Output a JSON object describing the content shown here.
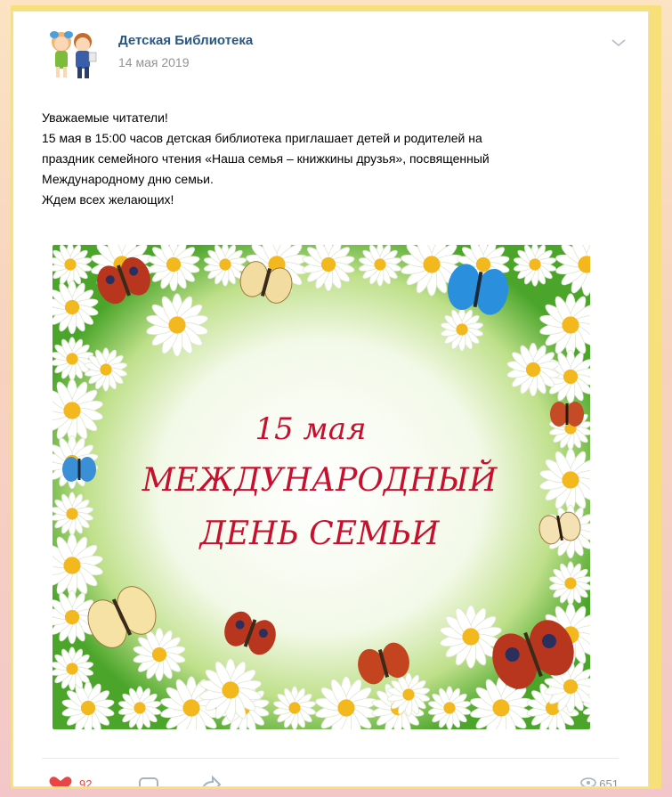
{
  "post": {
    "author": "Детская Библиотека",
    "date": "14 мая 2019",
    "text_lines": [
      "Уважаемые читатели!",
      "15 мая в 15:00 часов детская библиотека приглашает детей и родителей на",
      "праздник семейного чтения «Наша семья – книжкины друзья», посвященный",
      "Международному дню семьи.",
      "Ждем всех желающих!"
    ],
    "image": {
      "line1": "15 мая",
      "line2": "МЕЖДУНАРОДНЫЙ",
      "line3": "ДЕНЬ СЕМЬИ"
    },
    "likes": "92",
    "views": "651"
  },
  "icons": {
    "avatar": "children-avatar-icon",
    "menu": "chevron-down-icon",
    "like": "heart-icon",
    "comment": "comment-icon",
    "share": "share-icon",
    "views": "eye-icon"
  },
  "colors": {
    "author": "#2a5885",
    "like": "#e64646",
    "image_text": "#c8102e",
    "frame": "#f7e07a"
  }
}
